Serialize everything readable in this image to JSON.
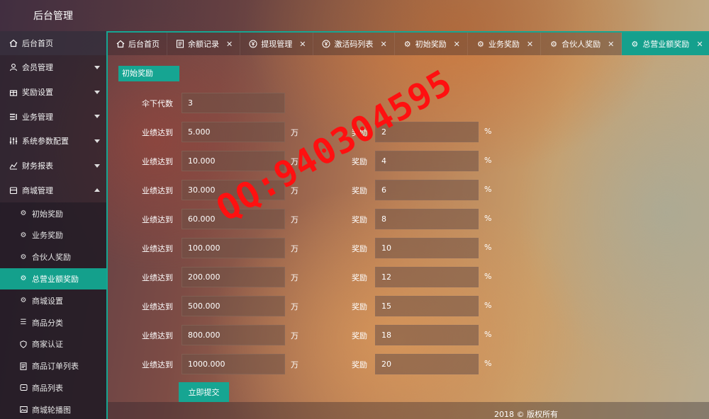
{
  "app": {
    "title": "后台管理"
  },
  "sidebar": {
    "items": [
      {
        "label": "后台首页",
        "icon": "home-icon"
      },
      {
        "label": "会员管理",
        "icon": "user-icon"
      },
      {
        "label": "奖励设置",
        "icon": "gift-icon"
      },
      {
        "label": "业务管理",
        "icon": "list-icon"
      },
      {
        "label": "系统参数配置",
        "icon": "sliders-icon"
      },
      {
        "label": "财务报表",
        "icon": "chart-icon"
      },
      {
        "label": "商城管理",
        "icon": "store-icon"
      }
    ],
    "sub_items": [
      {
        "label": "初始奖励",
        "icon": "award-icon"
      },
      {
        "label": "业务奖励",
        "icon": "award-icon"
      },
      {
        "label": "合伙人奖励",
        "icon": "award-icon"
      },
      {
        "label": "总营业额奖励",
        "icon": "award-icon"
      },
      {
        "label": "商城设置",
        "icon": "gear-icon"
      },
      {
        "label": "商品分类",
        "icon": "list-icon"
      },
      {
        "label": "商家认证",
        "icon": "shield-icon"
      },
      {
        "label": "商品订单列表",
        "icon": "document-icon"
      },
      {
        "label": "商品列表",
        "icon": "box-icon"
      },
      {
        "label": "商城轮播图",
        "icon": "image-icon"
      }
    ]
  },
  "tabs": [
    {
      "label": "后台首页",
      "icon": "home-icon"
    },
    {
      "label": "余额记录",
      "icon": "ledger-icon"
    },
    {
      "label": "提现管理",
      "icon": "yen-icon"
    },
    {
      "label": "激活码列表",
      "icon": "yen-icon"
    },
    {
      "label": "初始奖励",
      "icon": "award-icon"
    },
    {
      "label": "业务奖励",
      "icon": "award-icon"
    },
    {
      "label": "合伙人奖励",
      "icon": "award-icon"
    },
    {
      "label": "总营业额奖励",
      "icon": "award-icon"
    }
  ],
  "form": {
    "section_title": "初始奖励",
    "generations_label": "伞下代数",
    "generations_value": "3",
    "threshold_label": "业绩达到",
    "threshold_unit": "万",
    "reward_label": "奖励",
    "reward_unit": "%",
    "rows": [
      {
        "threshold": "5.000",
        "reward": "2"
      },
      {
        "threshold": "10.000",
        "reward": "4"
      },
      {
        "threshold": "30.000",
        "reward": "6"
      },
      {
        "threshold": "60.000",
        "reward": "8"
      },
      {
        "threshold": "100.000",
        "reward": "10"
      },
      {
        "threshold": "200.000",
        "reward": "12"
      },
      {
        "threshold": "500.000",
        "reward": "15"
      },
      {
        "threshold": "800.000",
        "reward": "18"
      },
      {
        "threshold": "1000.000",
        "reward": "20"
      }
    ],
    "submit_label": "立即提交"
  },
  "footer": {
    "text": "2018 © 版权所有"
  },
  "watermark": {
    "text": "QQ:940304595"
  },
  "colors": {
    "accent": "#16a592",
    "watermark": "#ff1010"
  }
}
